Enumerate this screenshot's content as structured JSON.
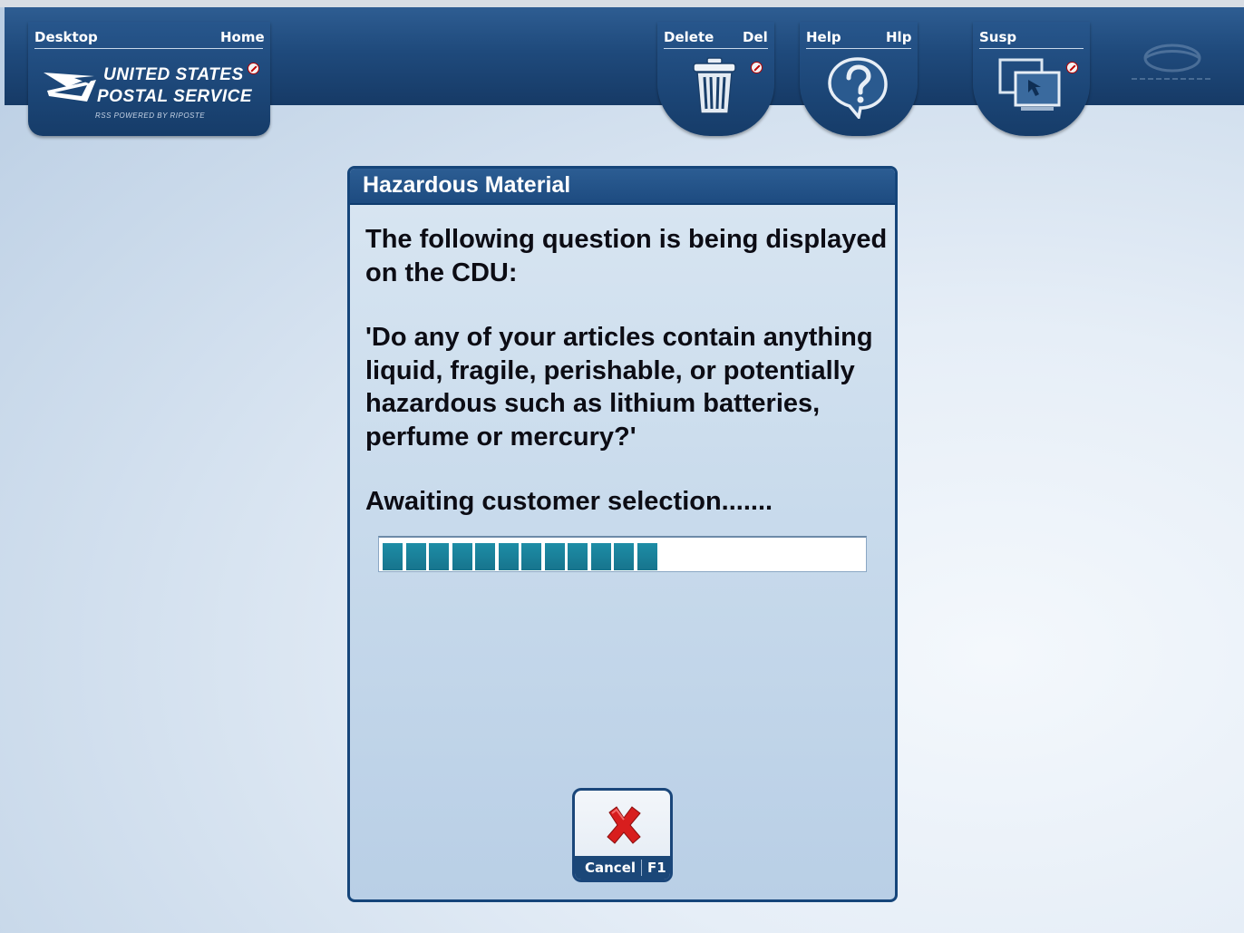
{
  "toolbar": {
    "desktop_label": "Desktop",
    "home_label": "Home",
    "brand_line1": "UNITED STATES",
    "brand_line2": "POSTAL SERVICE",
    "brand_sub": "RSS POWERED BY RIPOSTE",
    "delete_label": "Delete",
    "delete_key": "Del",
    "help_label": "Help",
    "help_key": "Hlp",
    "susp_label": "Susp",
    "icons": {
      "home": "usps-eagle-logo",
      "delete": "trash-icon",
      "help": "question-bubble-icon",
      "susp": "suspend-window-icon",
      "corner": "globe-logo-icon",
      "badge": "no-entry-badge-icon"
    }
  },
  "dialog": {
    "title": "Hazardous Material",
    "intro": "The following question is being displayed on the CDU:",
    "question": "'Do any of your articles contain anything liquid, fragile, perishable, or potentially hazardous such as lithium batteries, perfume or mercury?'",
    "status": "Awaiting customer selection.......",
    "progress": {
      "filled_segments": 12,
      "fraction": 0.56
    }
  },
  "cancel": {
    "label": "Cancel",
    "key": "F1",
    "icon": "red-x-icon"
  },
  "colors": {
    "toolbar": "#1f4a7c",
    "dialog_border": "#15457a",
    "progress_fill": "#1d8da6",
    "cancel_x": "#d81e1e"
  }
}
